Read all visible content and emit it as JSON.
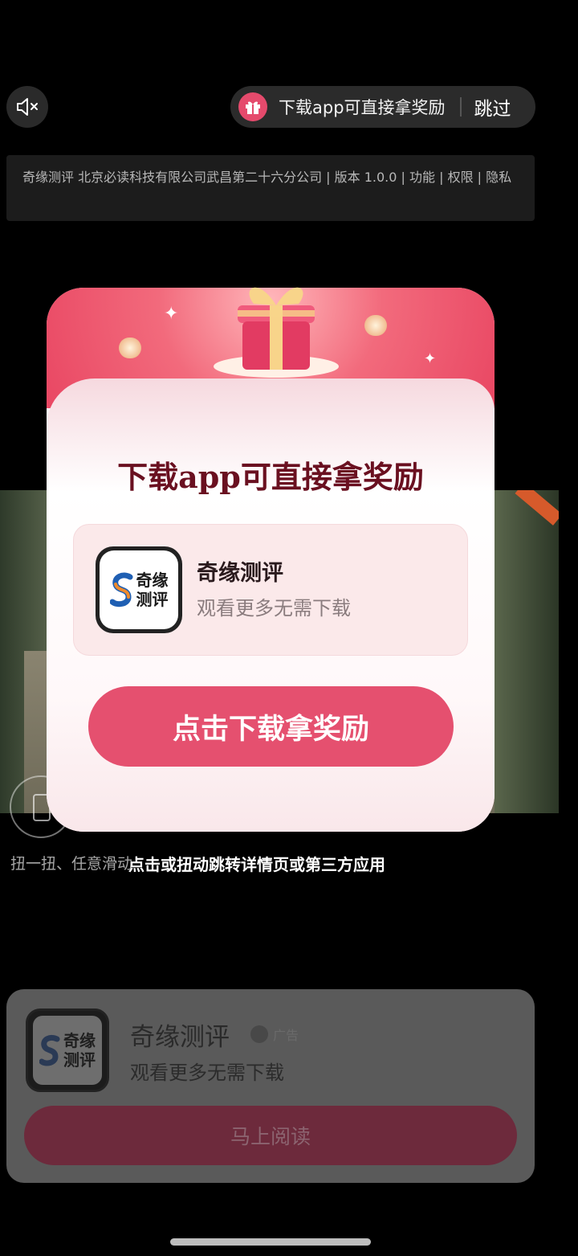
{
  "top": {
    "reward_text": "下载app可直接拿奖励",
    "skip_label": "跳过"
  },
  "info_bar": {
    "text": "奇缘测评 北京必读科技有限公司武昌第二十六分公司 | 版本 1.0.0 | 功能 | 权限 | 隐私"
  },
  "hints": {
    "shake": "扭一扭、任意滑动",
    "jump": "点击或扭动跳转详情页或第三方应用"
  },
  "popup": {
    "title": "下载app可直接拿奖励",
    "app_name": "奇缘测评",
    "app_desc": "观看更多无需下载",
    "button_label": "点击下载拿奖励",
    "logo_line1": "奇缘",
    "logo_line2": "测评"
  },
  "ad_card": {
    "app_name": "奇缘测评",
    "badge": "广告",
    "desc": "观看更多无需下载",
    "button_label": "马上阅读",
    "logo_line1": "奇缘",
    "logo_line2": "测评"
  },
  "colors": {
    "accent": "#e5506f",
    "title": "#6a1020",
    "overlay_button": "#6d2a3c"
  }
}
